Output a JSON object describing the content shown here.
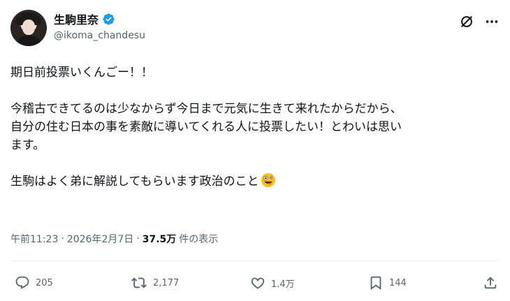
{
  "author": {
    "display_name": "生駒里奈",
    "handle": "@ikoma_chandesu",
    "verified_icon": "verified-badge-icon",
    "accent": "#1d9bf0"
  },
  "tweet": {
    "lines": [
      "期日前投票いくんごー！！",
      "",
      "今稽古できてるのは少なからず今日まで元気に生きて来れたからだから、",
      "自分の住む日本の事を素敵に導いてくれる人に投票したい！とわいは思い",
      "ます。",
      "",
      "生駒はよく弟に解説してもらいます政治のこと"
    ],
    "emoji": "zany-face-emoji"
  },
  "meta": {
    "time": "午前11:23",
    "separator": "·",
    "date": "2026年2月7日",
    "views_count": "37.5万",
    "views_label": "件の表示"
  },
  "actions": {
    "replies": "205",
    "reposts": "2,177",
    "likes": "1.4万",
    "bookmarks": "144"
  }
}
